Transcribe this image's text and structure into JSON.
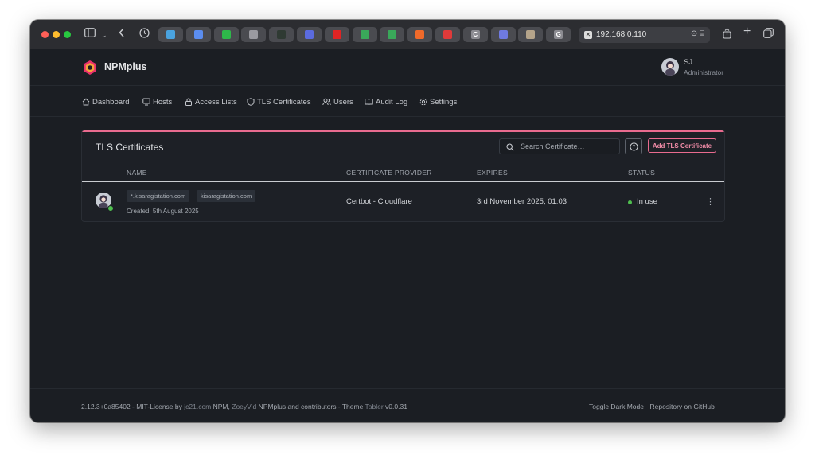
{
  "browser": {
    "url": "192.168.0.110",
    "tabs": [
      {
        "name": "tab-1",
        "color": "#4aa3df",
        "glyph": ""
      },
      {
        "name": "tab-2",
        "color": "#5b8def",
        "glyph": ""
      },
      {
        "name": "tab-3",
        "color": "#2eb84a",
        "glyph": ""
      },
      {
        "name": "tab-4",
        "color": "#9a9aa0",
        "glyph": ""
      },
      {
        "name": "tab-5",
        "color": "#2f3a33",
        "glyph": ""
      },
      {
        "name": "tab-6",
        "color": "#5b6bdf",
        "glyph": ""
      },
      {
        "name": "tab-7",
        "color": "#e02424",
        "glyph": ""
      },
      {
        "name": "tab-8",
        "color": "#3aa85a",
        "glyph": ""
      },
      {
        "name": "tab-9",
        "color": "#3aa85a",
        "glyph": ""
      },
      {
        "name": "tab-10",
        "color": "#f06a2a",
        "glyph": ""
      },
      {
        "name": "tab-11",
        "color": "#e03a3a",
        "glyph": ""
      },
      {
        "name": "tab-12",
        "color": "#8c8c92",
        "glyph": "C"
      },
      {
        "name": "tab-13",
        "color": "#6f7ae0",
        "glyph": ""
      },
      {
        "name": "tab-14",
        "color": "#b5a48a",
        "glyph": ""
      },
      {
        "name": "tab-15",
        "color": "#8c8c92",
        "glyph": "G"
      }
    ]
  },
  "app": {
    "brand": "NPMplus",
    "accent": "#e96b8f",
    "user": {
      "name": "SJ",
      "role": "Administrator"
    }
  },
  "nav": [
    {
      "id": "dashboard",
      "label": "Dashboard",
      "icon": "home-icon"
    },
    {
      "id": "hosts",
      "label": "Hosts",
      "icon": "monitor-icon"
    },
    {
      "id": "access-lists",
      "label": "Access Lists",
      "icon": "lock-icon"
    },
    {
      "id": "tls-certificates",
      "label": "TLS Certificates",
      "icon": "shield-icon"
    },
    {
      "id": "users",
      "label": "Users",
      "icon": "users-icon"
    },
    {
      "id": "audit-log",
      "label": "Audit Log",
      "icon": "book-icon"
    },
    {
      "id": "settings",
      "label": "Settings",
      "icon": "gear-icon"
    }
  ],
  "card": {
    "title": "TLS Certificates",
    "search_placeholder": "Search Certificate…",
    "add_button": "Add TLS Certificate",
    "columns": {
      "name": "NAME",
      "provider": "CERTIFICATE PROVIDER",
      "expires": "EXPIRES",
      "status": "STATUS"
    },
    "rows": [
      {
        "domains": [
          "*.kisaragistation.com",
          "kisaragistation.com"
        ],
        "created": "Created: 5th August 2025",
        "provider": "Certbot - Cloudflare",
        "expires": "3rd November 2025, 01:03",
        "status": "In use"
      }
    ]
  },
  "footer": {
    "version": "2.12.3+0a85402 - MIT-License by ",
    "link1": "jc21.com",
    "t1": " NPM, ",
    "link2": "ZoeyVid",
    "t2": " NPMplus and contributors - Theme ",
    "link3": "Tabler",
    "t3": " v0.0.31",
    "toggle": "Toggle Dark Mode",
    "sep": " · ",
    "repo": "Repository on GitHub"
  }
}
